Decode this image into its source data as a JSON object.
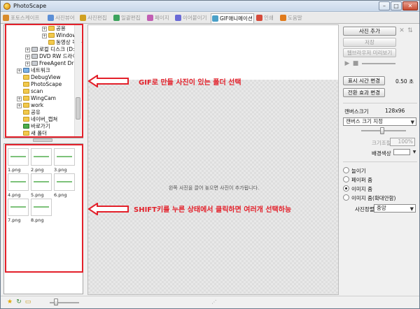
{
  "window": {
    "title": "PhotoScape"
  },
  "tabs": [
    {
      "label": "포토스케이프",
      "color": "#d98b2b"
    },
    {
      "label": "사진뷰어",
      "color": "#5c8fd6"
    },
    {
      "label": "사진편집",
      "color": "#d0a020"
    },
    {
      "label": "일괄편집",
      "color": "#3da35d"
    },
    {
      "label": "페이지",
      "color": "#c25fb4"
    },
    {
      "label": "이어붙이기",
      "color": "#6a6ad6"
    },
    {
      "label": "GIF애니메이션",
      "color": "#4aa0c8"
    },
    {
      "label": "인쇄",
      "color": "#d64a3a"
    },
    {
      "label": "도움말",
      "color": "#e07b1c"
    }
  ],
  "tree": {
    "items": [
      {
        "label": "공용",
        "icon": "folder",
        "expander": "+"
      },
      {
        "label": "Windows",
        "icon": "folder",
        "expander": "+"
      },
      {
        "label": "동영상 녹화",
        "icon": "folder",
        "expander": ""
      },
      {
        "label": "로컬 디스크 (D:",
        "icon": "drive",
        "expander": "+"
      },
      {
        "label": "DVD RW 드라이",
        "icon": "drive",
        "expander": "+"
      },
      {
        "label": "FreeAgent Driv",
        "icon": "drive",
        "expander": "+"
      },
      {
        "label": "네트워크",
        "icon": "network",
        "expander": "+"
      },
      {
        "label": "DebugView",
        "icon": "folder",
        "expander": ""
      },
      {
        "label": "PhotoScape",
        "icon": "folder",
        "expander": ""
      },
      {
        "label": "scan",
        "icon": "folder",
        "expander": ""
      },
      {
        "label": "WingCam",
        "icon": "folder",
        "expander": "+"
      },
      {
        "label": "work",
        "icon": "folder",
        "expander": "+"
      },
      {
        "label": "공유",
        "icon": "folder",
        "expander": ""
      },
      {
        "label": "네이버_캡쳐",
        "icon": "folder",
        "expander": ""
      },
      {
        "label": "바로가기",
        "icon": "shortcut",
        "expander": ""
      },
      {
        "label": "새 폴더",
        "icon": "folder",
        "expander": ""
      }
    ]
  },
  "thumbnails": [
    "1.png",
    "2.png",
    "3.png",
    "4.png",
    "5.png",
    "6.png",
    "7.png",
    "8.png"
  ],
  "annotations": {
    "folder_hint": "GIF로 만들 사진이 있는 폴더 선택",
    "shift_hint": "SHIFT키를 누른 상태에서 클릭하면 여러개 선택하능",
    "accent_color": "#e3202a"
  },
  "canvas": {
    "empty_hint": "왼쪽 사진을 끌어 놓으면 사진이 추가됩니다."
  },
  "right": {
    "add_photo": "사진 추가",
    "save": "저장",
    "preview": "웹브라우저 미리보기",
    "change_time": "표시 시간 변경",
    "time_value": "0.50 초",
    "change_effect": "전환 효과 변경",
    "canvas_size_label": "캔버스크기",
    "canvas_size_value": "128x96",
    "canvas_size_select": "캔버스 크기 지정",
    "resize_label": "크기조절",
    "resize_value": "100%",
    "bg_color_label": "배경색상",
    "radios": [
      {
        "label": "늘이기",
        "checked": false
      },
      {
        "label": "페이퍼 줌",
        "checked": false
      },
      {
        "label": "이미지 줌",
        "checked": true
      },
      {
        "label": "이미지 줌(확대안함)",
        "checked": false
      }
    ],
    "align_label": "사진정렬",
    "align_value": "중앙"
  }
}
